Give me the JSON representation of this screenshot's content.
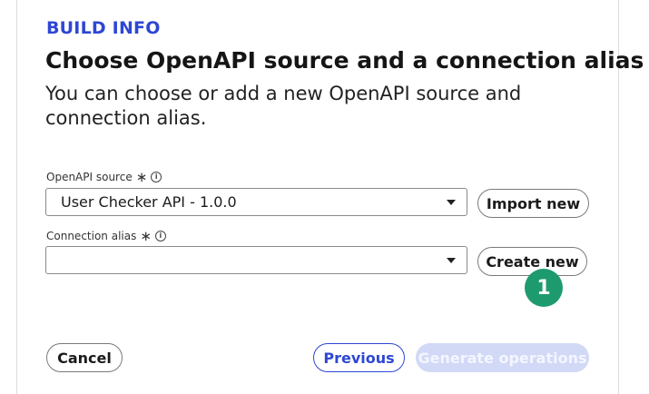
{
  "header": {
    "eyebrow": "BUILD INFO",
    "title": "Choose OpenAPI source and a connection alias",
    "description": "You can choose or add a new OpenAPI source and connection alias."
  },
  "openapi_source": {
    "label": "OpenAPI source",
    "required_mark": "∗",
    "info_icon": "info-icon",
    "value": "User Checker API - 1.0.0",
    "import_label": "Import new"
  },
  "connection_alias": {
    "label": "Connection alias",
    "required_mark": "∗",
    "info_icon": "info-icon",
    "value": "",
    "create_label": "Create new"
  },
  "step_badge": "1",
  "footer": {
    "cancel_label": "Cancel",
    "previous_label": "Previous",
    "generate_label": "Generate operations"
  },
  "colors": {
    "accent": "#2e47d4",
    "badge": "#1e9b6e",
    "disabled_button": "#d2d9f7"
  }
}
